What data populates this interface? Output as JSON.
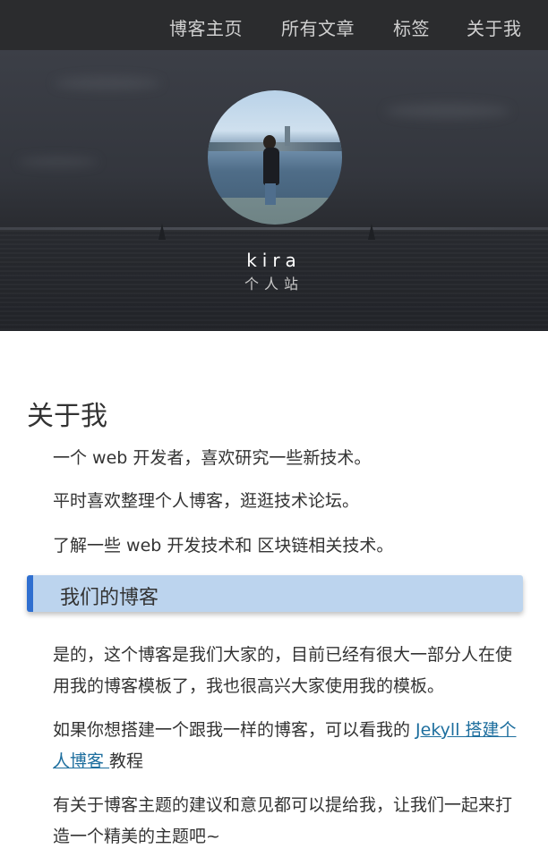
{
  "nav": {
    "items": [
      {
        "label": "博客主页"
      },
      {
        "label": "所有文章"
      },
      {
        "label": "标签"
      },
      {
        "label": "关于我"
      }
    ]
  },
  "hero": {
    "title": "kira",
    "subtitle": "个人站"
  },
  "main": {
    "title": "关于我",
    "intro": [
      "一个 web 开发者，喜欢研究一些新技术。",
      "平时喜欢整理个人博客，逛逛技术论坛。",
      "了解一些 web 开发技术和 区块链相关技术。"
    ],
    "section_title": "我们的博客",
    "blog_paragraphs": {
      "p1": "是的，这个博客是我们大家的，目前已经有很大一部分人在使用我的博客模板了，我也很高兴大家使用我的模板。",
      "p2_before": "如果你想搭建一个跟我一样的博客，可以看我的 ",
      "p2_link": "Jekyll 搭建个人博客 ",
      "p2_after": " 教程",
      "p3": "有关于博客主题的建议和意见都可以提给我，让我们一起来打造一个精美的主题吧~"
    }
  },
  "colors": {
    "nav_bg": "#2b2c2e",
    "section_bg": "#bcd4ee",
    "section_accent": "#2f6fd0",
    "link": "#1d6e9e"
  }
}
